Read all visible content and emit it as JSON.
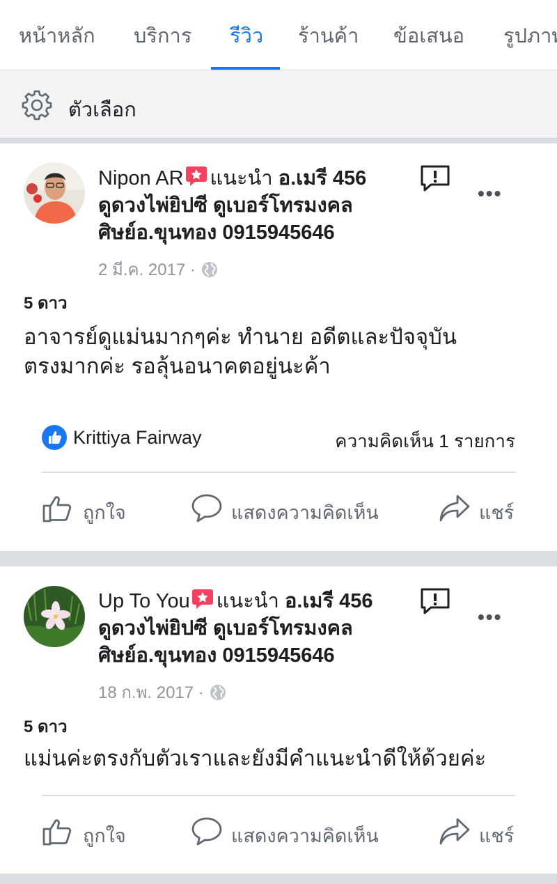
{
  "tabs": [
    {
      "label": "หน้าหลัก",
      "active": false
    },
    {
      "label": "บริการ",
      "active": false
    },
    {
      "label": "รีวิว",
      "active": true
    },
    {
      "label": "ร้านค้า",
      "active": false
    },
    {
      "label": "ข้อเสนอ",
      "active": false
    },
    {
      "label": "รูปภาพ",
      "active": false
    }
  ],
  "options": {
    "label": "ตัวเลือก",
    "icon": "gear-icon"
  },
  "colors": {
    "accent": "#1877f2",
    "recommend_badge": "#f3425f",
    "muted_text": "#90949c"
  },
  "reviews": [
    {
      "author": "Nipon AR",
      "recommends": "แนะนำ",
      "page_line1": "อ.เมรี 456",
      "page_line2": "ดูดวงไพ่ยิปซี ดูเบอร์โทรมงคล",
      "page_line3": "ศิษย์อ.ขุนทอง 0915945646",
      "date": "2 มี.ค. 2017",
      "privacy_icon": "globe-icon",
      "rating": "5 ดาว",
      "text_line1": "อาจารย์ดูแม่นมากๆค่ะ ทำนาย อดีตและปัจจุบัน",
      "text_line2": "ตรงมากค่ะ รอลุ้นอนาคตอยู่นะค้า",
      "liker": "Krittiya Fairway",
      "comments": "ความคิดเห็น 1 รายการ",
      "actions": {
        "like": "ถูกใจ",
        "comment": "แสดงความคิดเห็น",
        "share": "แชร์"
      }
    },
    {
      "author": "Up To You",
      "recommends": "แนะนำ",
      "page_line1": "อ.เมรี 456",
      "page_line2": "ดูดวงไพ่ยิปซี ดูเบอร์โทรมงคล",
      "page_line3": "ศิษย์อ.ขุนทอง 0915945646",
      "date": "18 ก.พ. 2017",
      "privacy_icon": "globe-icon",
      "rating": "5 ดาว",
      "text_line1": "แม่นค่ะตรงกับตัวเราและยังมีคำแนะนำดีให้ด้วยค่ะ",
      "actions": {
        "like": "ถูกใจ",
        "comment": "แสดงความคิดเห็น",
        "share": "แชร์"
      }
    }
  ],
  "more_label": "•••"
}
